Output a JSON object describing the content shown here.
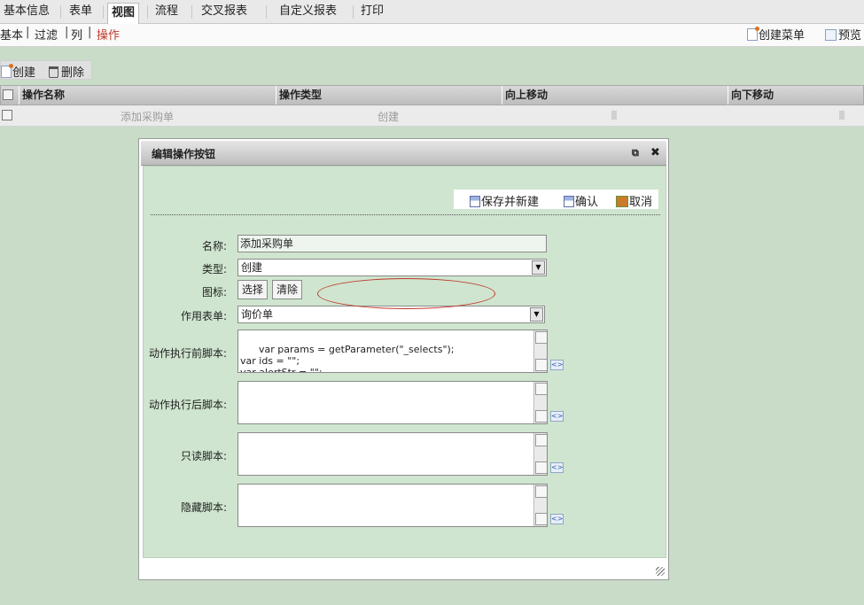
{
  "tabs": [
    "基本信息",
    "表单",
    "视图",
    "流程",
    "交叉报表",
    "自定义报表",
    "打印"
  ],
  "active_tab": "视图",
  "subnav": {
    "links": [
      "基本",
      "过滤",
      "列",
      "操作"
    ],
    "separator": "|",
    "active": "操作",
    "create_menu": "创建菜单",
    "preview": "预览"
  },
  "toolbar": {
    "create": "创建",
    "delete": "删除"
  },
  "grid": {
    "columns": [
      "操作名称",
      "操作类型",
      "向上移动",
      "向下移动"
    ],
    "rows": [
      {
        "name": "添加采购单",
        "type": "创建"
      }
    ]
  },
  "dialog": {
    "title": "编辑操作按钮",
    "close_glyph": "✖",
    "popout_glyph": "⧉",
    "actions": {
      "save_new": "保存并新建",
      "confirm": "确认",
      "cancel": "取消"
    },
    "labels": {
      "name": "名称:",
      "type": "类型:",
      "icon": "图标:",
      "form": "作用表单:",
      "before_script": "动作执行前脚本:",
      "after_script": "动作执行后脚本:",
      "readonly_script": "只读脚本:",
      "hidden_script": "隐藏脚本:"
    },
    "values": {
      "name": "添加采购单",
      "type": "创建",
      "form": "询价单",
      "before_script": "var params = getParameter(\"_selects\");\nvar ids = \"\";\nvar alertStr = \"\";",
      "after_script": "",
      "readonly_script": "",
      "hidden_script": ""
    },
    "icon_buttons": {
      "choose": "选择",
      "clear": "清除"
    },
    "code_glyph": "<>",
    "select_arrow": "▼"
  },
  "highlight_color": "#c0392b"
}
